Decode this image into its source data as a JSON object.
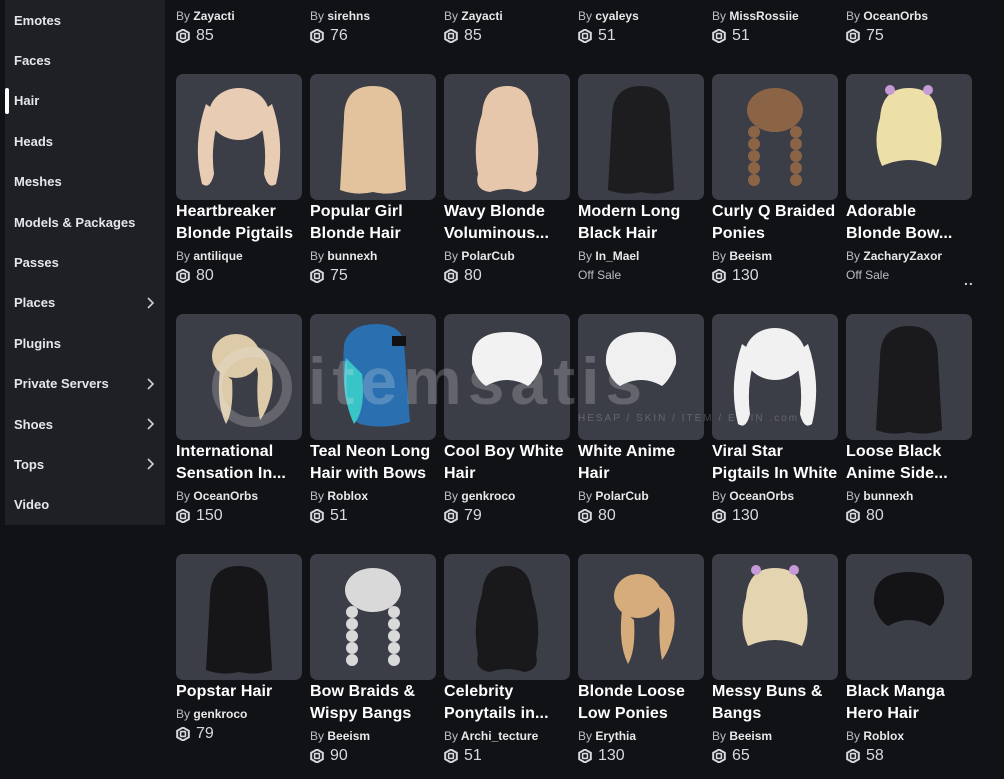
{
  "sidebar": {
    "items": [
      {
        "label": "Emotes",
        "chevron": false,
        "active": false
      },
      {
        "label": "Faces",
        "chevron": false,
        "active": false
      },
      {
        "label": "Hair",
        "chevron": false,
        "active": true
      },
      {
        "label": "Heads",
        "chevron": false,
        "active": false
      },
      {
        "label": "Meshes",
        "chevron": false,
        "active": false
      },
      {
        "label": "Models & Packages",
        "chevron": false,
        "active": false
      },
      {
        "label": "Passes",
        "chevron": false,
        "active": false
      },
      {
        "label": "Places",
        "chevron": true,
        "active": false
      },
      {
        "label": "Plugins",
        "chevron": false,
        "active": false
      },
      {
        "label": "Private Servers",
        "chevron": true,
        "active": false
      },
      {
        "label": "Shoes",
        "chevron": true,
        "active": false
      },
      {
        "label": "Tops",
        "chevron": true,
        "active": false
      },
      {
        "label": "Video",
        "chevron": false,
        "active": false
      }
    ]
  },
  "top_row": [
    {
      "creator": "Zayacti",
      "price": "85"
    },
    {
      "creator": "sirehns",
      "price": "76"
    },
    {
      "creator": "Zayacti",
      "price": "85"
    },
    {
      "creator": "cyaleys",
      "price": "51"
    },
    {
      "creator": "MissRossiie",
      "price": "51"
    },
    {
      "creator": "OceanOrbs",
      "price": "75"
    }
  ],
  "by_label": "By",
  "items": [
    {
      "line1": "Heartbreaker",
      "line2": "Blonde Pigtails",
      "creator": "antilique",
      "price": "80",
      "offsale": false,
      "color": "#e8cdb4",
      "shape": "pigtails"
    },
    {
      "line1": "Popular Girl",
      "line2": "Blonde Hair",
      "creator": "bunnexh",
      "price": "75",
      "offsale": false,
      "color": "#e3c39e",
      "shape": "long"
    },
    {
      "line1": "Wavy Blonde",
      "line2": "Voluminous...",
      "creator": "PolarCub",
      "price": "80",
      "offsale": false,
      "color": "#e6c7ac",
      "shape": "wavy"
    },
    {
      "line1": "Modern Long",
      "line2": "Black Hair",
      "creator": "In_Mael",
      "price": "",
      "offsale": true,
      "color": "#1d1d1f",
      "shape": "long"
    },
    {
      "line1": "Curly Q Braided",
      "line2": "Ponies",
      "creator": "Beeism",
      "price": "130",
      "offsale": false,
      "color": "#8b6446",
      "shape": "braids"
    },
    {
      "line1": "Adorable",
      "line2": "Blonde Bow...",
      "creator": "ZacharyZaxor",
      "price": "",
      "offsale": true,
      "color": "#ece0a8",
      "shape": "bow"
    },
    {
      "line1": "International",
      "line2": "Sensation In...",
      "creator": "OceanOrbs",
      "price": "150",
      "offsale": false,
      "color": "#dccaa8",
      "shape": "pony"
    },
    {
      "line1": "Teal Neon Long",
      "line2": "Hair with Bows",
      "creator": "Roblox",
      "price": "51",
      "offsale": false,
      "color": "#2aa9b7",
      "shape": "teal"
    },
    {
      "line1": "Cool Boy White",
      "line2": "Hair",
      "creator": "genkroco",
      "price": "79",
      "offsale": false,
      "color": "#f2f2f2",
      "shape": "short"
    },
    {
      "line1": "White Anime",
      "line2": "Hair",
      "creator": "PolarCub",
      "price": "80",
      "offsale": false,
      "color": "#f0f0f0",
      "shape": "short"
    },
    {
      "line1": "Viral Star",
      "line2": "Pigtails In White",
      "creator": "OceanOrbs",
      "price": "130",
      "offsale": false,
      "color": "#f1f1f1",
      "shape": "pigtails"
    },
    {
      "line1": "Loose Black",
      "line2": "Anime Side...",
      "creator": "bunnexh",
      "price": "80",
      "offsale": false,
      "color": "#1a1a1c",
      "shape": "long"
    },
    {
      "line1": "Popstar Hair",
      "line2": "",
      "creator": "genkroco",
      "price": "79",
      "offsale": false,
      "color": "#161618",
      "shape": "long"
    },
    {
      "line1": "Bow Braids &",
      "line2": "Wispy Bangs",
      "creator": "Beeism",
      "price": "90",
      "offsale": false,
      "color": "#d9d9d9",
      "shape": "braids"
    },
    {
      "line1": "Celebrity",
      "line2": "Ponytails in...",
      "creator": "Archi_tecture",
      "price": "51",
      "offsale": false,
      "color": "#19191b",
      "shape": "wavy"
    },
    {
      "line1": "Blonde Loose",
      "line2": "Low Ponies",
      "creator": "Erythia",
      "price": "130",
      "offsale": false,
      "color": "#d6ac7c",
      "shape": "pony"
    },
    {
      "line1": "Messy Buns &",
      "line2": "Bangs",
      "creator": "Beeism",
      "price": "65",
      "offsale": false,
      "color": "#e4d4b0",
      "shape": "bow"
    },
    {
      "line1": "Black Manga",
      "line2": "Hero Hair",
      "creator": "Roblox",
      "price": "58",
      "offsale": false,
      "color": "#141416",
      "shape": "short"
    }
  ],
  "offsale_label": "Off Sale",
  "more_label": "..",
  "watermark": {
    "text": "itemsatis",
    "sub": "HESAP / SKIN / ITEM / E-PIN .com"
  }
}
